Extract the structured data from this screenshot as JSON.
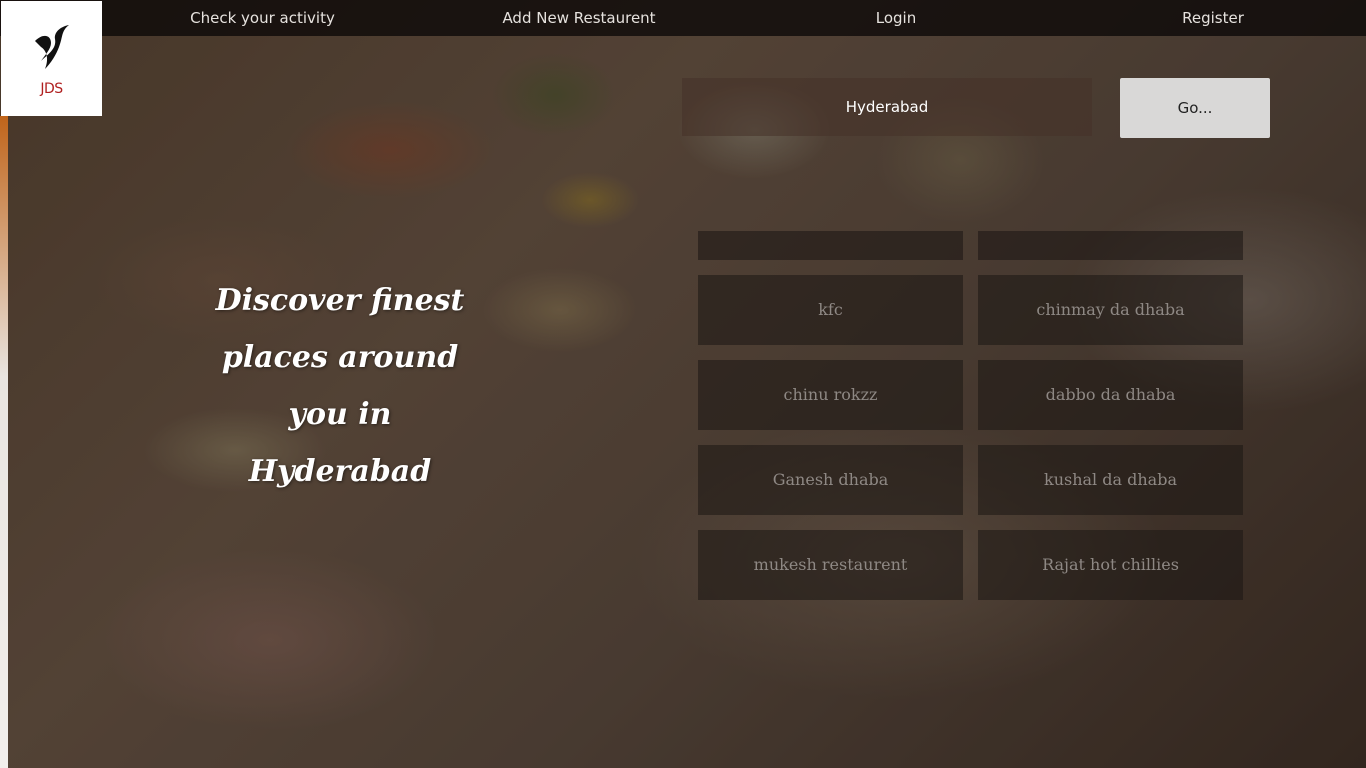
{
  "nav": {
    "activity": "Check your activity",
    "add_restaurant": "Add New Restaurent",
    "login": "Login",
    "register": "Register"
  },
  "logo": {
    "text": "JDS",
    "icon": "bird-logo-icon",
    "color": "#b02020"
  },
  "search": {
    "value": "Hyderabad",
    "button_label": "Go..."
  },
  "tagline": {
    "line1": "Discover finest",
    "line2": "places around you in",
    "line3": "Hyderabad"
  },
  "restaurants": [
    "kfc",
    "chinmay da dhaba",
    "chinu rokzz",
    "dabbo da dhaba",
    "Ganesh dhaba",
    "kushal da dhaba",
    "mukesh restaurent",
    "Rajat hot chillies"
  ]
}
